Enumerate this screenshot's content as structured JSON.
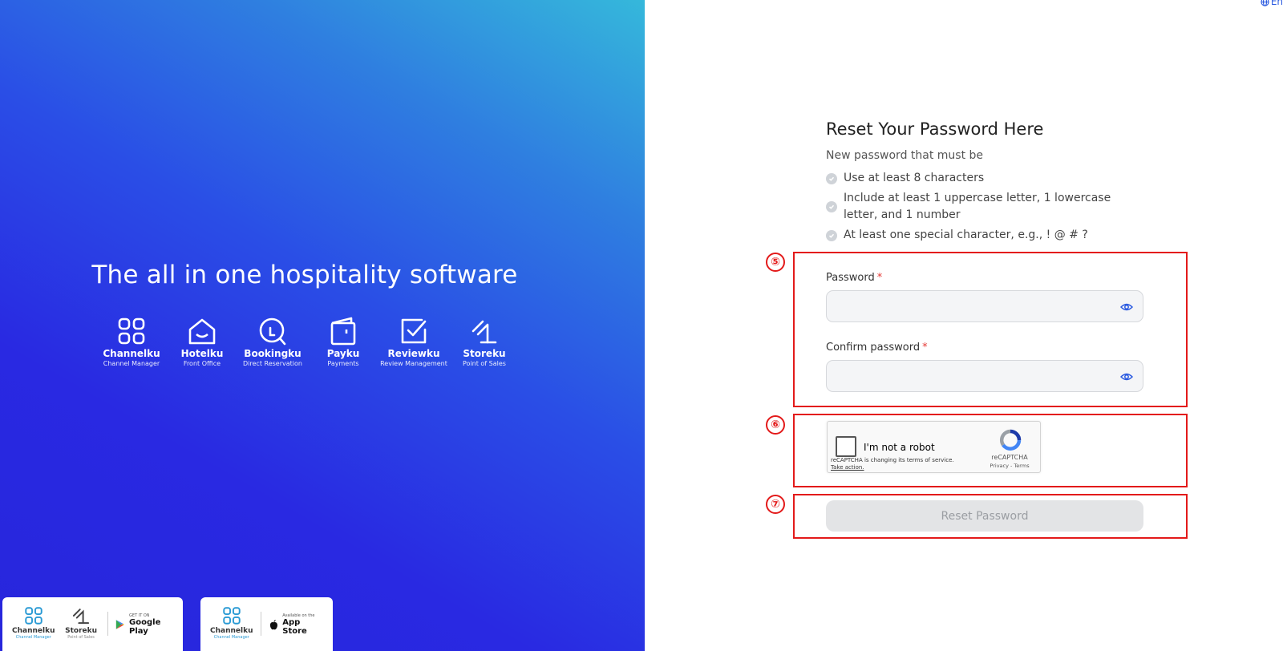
{
  "hero": {
    "title": "The all in one hospitality software",
    "products": [
      {
        "name": "Channelku",
        "subtitle": "Channel Manager",
        "icon": "grid-icon"
      },
      {
        "name": "Hotelku",
        "subtitle": "Front Office",
        "icon": "house-icon"
      },
      {
        "name": "Bookingku",
        "subtitle": "Direct Reservation",
        "icon": "search-bubble-icon"
      },
      {
        "name": "Payku",
        "subtitle": "Payments",
        "icon": "wallet-icon"
      },
      {
        "name": "Reviewku",
        "subtitle": "Review Management",
        "icon": "check-square-icon"
      },
      {
        "name": "Storeku",
        "subtitle": "Point of Sales",
        "icon": "storeku-icon"
      }
    ]
  },
  "downloads": {
    "play": {
      "apps": [
        {
          "name": "Channelku",
          "subtitle": "Channel Manager"
        },
        {
          "name": "Storeku",
          "subtitle": "Point of Sales"
        }
      ],
      "badge_small": "GET IT ON",
      "badge_big": "Google Play"
    },
    "apple": {
      "apps": [
        {
          "name": "Channelku",
          "subtitle": "Channel Manager"
        }
      ],
      "badge_small": "Available on the",
      "badge_big": "App Store"
    }
  },
  "language": {
    "label": "En"
  },
  "form": {
    "title": "Reset Your Password Here",
    "subtitle": "New password that must be",
    "rules": [
      "Use at least 8 characters",
      "Include at least 1 uppercase letter, 1 lowercase letter, and 1 number",
      "At least one special character, e.g., ! @ # ?"
    ],
    "password_label": "Password",
    "confirm_label": "Confirm password",
    "required_mark": "*",
    "password_value": "",
    "confirm_value": "",
    "submit_label": "Reset Password"
  },
  "recaptcha": {
    "label": "I'm not a robot",
    "notice": "reCAPTCHA is changing its terms of service.",
    "notice_link": "Take action.",
    "brand": "reCAPTCHA",
    "links": "Privacy - Terms"
  },
  "annotations": [
    "⑤",
    "⑥",
    "⑦"
  ],
  "colors": {
    "accent": "#2a5ae0",
    "annotation": "#e31a1a",
    "required": "#e53935",
    "disabled_button": "#e3e4e6"
  }
}
